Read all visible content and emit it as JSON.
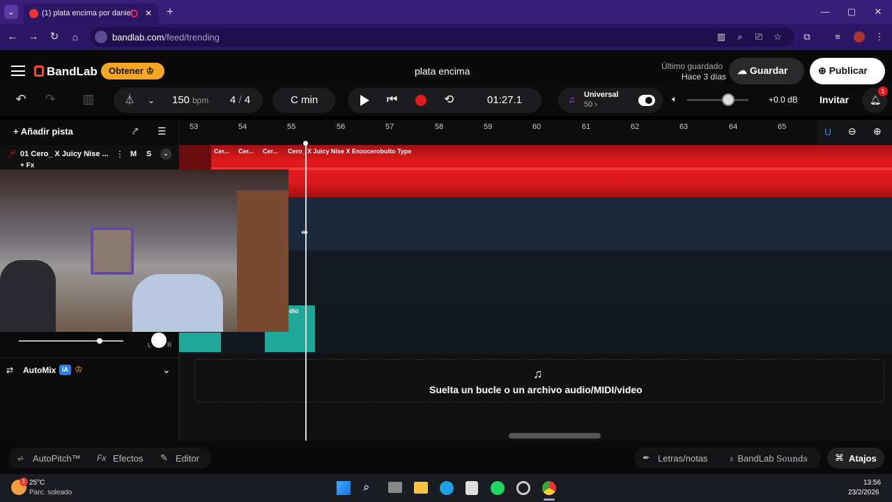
{
  "browser": {
    "tab_title": "(1) plata encima por daniel",
    "url_host": "bandlab.com",
    "url_path": "/feed/trending"
  },
  "app": {
    "brand": "BandLab",
    "get_button": "Obtener",
    "project_title": "plata encima",
    "last_saved_label": "Último guardado",
    "last_saved_time": "Hace 3 días",
    "save_button": "Guardar",
    "publish_button": "Publicar"
  },
  "controls": {
    "tempo": "150",
    "tempo_unit": "bpm",
    "time_sig_num": "4",
    "time_sig_den": "4",
    "key": "C min",
    "position": "01:27.1",
    "preset_name": "Universal",
    "preset_value": "50",
    "volume_db": "+0.0 dB",
    "invite": "Invitar",
    "notifications_count": "1"
  },
  "ruler": {
    "bars": [
      "53",
      "54",
      "55",
      "56",
      "57",
      "58",
      "59",
      "60",
      "61",
      "62",
      "63",
      "64",
      "65"
    ]
  },
  "tracks": {
    "add_track": "Añadir pista",
    "track1_name": "01  Cero_ X Juicy Nise ...",
    "track1_mute": "M",
    "track1_solo": "S",
    "track1_fx": "+ Fx",
    "clip_labels": [
      "Cer...",
      "Cer...",
      "Cer...",
      "Cero_ X Juicy Nise X Enzocerobulto Type"
    ],
    "audio_clip_label": "dio",
    "pan_left": "L",
    "pan_right": "R",
    "automix": "AutoMix",
    "automix_badge": "IA",
    "drop_hint": "Suelta un bucle o un archivo audio/MIDI/video"
  },
  "bottom": {
    "autopitch": "AutoPitch™",
    "effects_prefix": "Fx",
    "effects": "Efectos",
    "editor": "Editor",
    "lyrics": "Letras/notas",
    "sounds_brand": "BandLab",
    "sounds": "Sounds",
    "shortcuts": "Atajos"
  },
  "taskbar": {
    "weather_temp": "25°C",
    "weather_desc": "Parc. soleado",
    "weather_badge": "1",
    "time": "13:56",
    "date": "23/2/2026"
  },
  "colors": {
    "accent_purple": "#3a1f7a",
    "waveform_red": "#e0191c",
    "clip_teal": "#1fa89a",
    "get_button_orange": "#f5a623"
  }
}
